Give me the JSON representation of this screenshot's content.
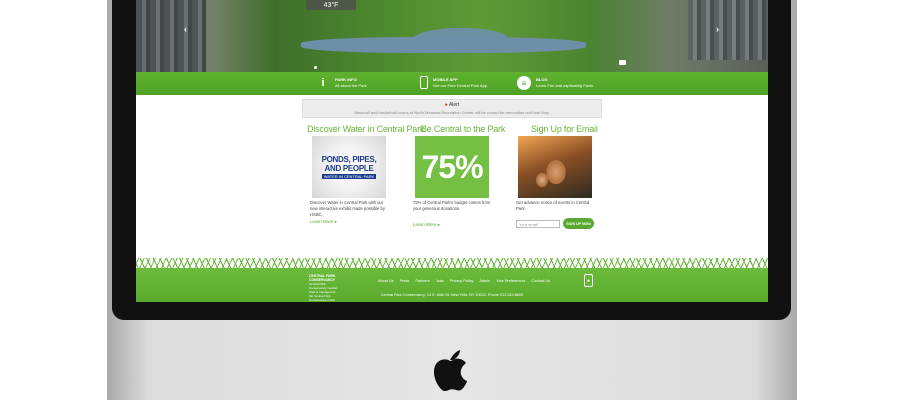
{
  "hero": {
    "weather": "43°F",
    "prev_arrow": "‹",
    "next_arrow": "›"
  },
  "strip": {
    "items": [
      {
        "title": "PARK INFO",
        "subtitle": "All about the Park",
        "icon": "info-icon",
        "glyph": "i"
      },
      {
        "title": "MOBILE APP",
        "subtitle": "Get our Free Central Park App",
        "icon": "phone-icon",
        "glyph": ""
      },
      {
        "title": "BLOG",
        "subtitle": "Learn Fun and captivating Facts",
        "icon": "chat-icon",
        "glyph": "≡"
      }
    ]
  },
  "alert": {
    "label": "Alert",
    "text": "Baseball and basketball courts at North Meadow Recreation Center will be closed for renovation until late May."
  },
  "columns": [
    {
      "title": "Discover Water in Central Park",
      "image": {
        "line1": "PONDS, PIPES,",
        "line2": "AND PEOPLE",
        "sub": "WATER IN CENTRAL PARK"
      },
      "description": "Discover Water in Central Park with our new interactive exhibit made possible by HSBC.",
      "link": "Learn More ▸"
    },
    {
      "title": "Be Central to the Park",
      "image": {
        "text": "75%"
      },
      "description": "75% of Central Park's budget comes from your generous donations.",
      "link": "Learn More ▸"
    },
    {
      "title": "Sign Up for Email",
      "description": "Get advance notice of events in Central Park.",
      "email_placeholder": "Your email",
      "button": "SIGN UP NOW"
    }
  ],
  "footer": {
    "logo_name": "CENTRAL PARK CONSERVANCY",
    "logo_tagline": "Central Park Conservancy Central Park is managed by the Central Park Conservancy under a contract with the City of New York",
    "nav": [
      "About Us",
      "Press",
      "Partners",
      "Jobs",
      "Privacy Policy",
      "Admin",
      "Your Preferences",
      "Contact Us"
    ],
    "badge": "♠",
    "address": "Central Park Conservancy, 14 E. 60th St. New York, NY 10022, Phone 212.310.6600"
  },
  "colors": {
    "brand_green": "#5aa830",
    "title_green": "#6ab43a",
    "alert_red": "#e0281a"
  }
}
